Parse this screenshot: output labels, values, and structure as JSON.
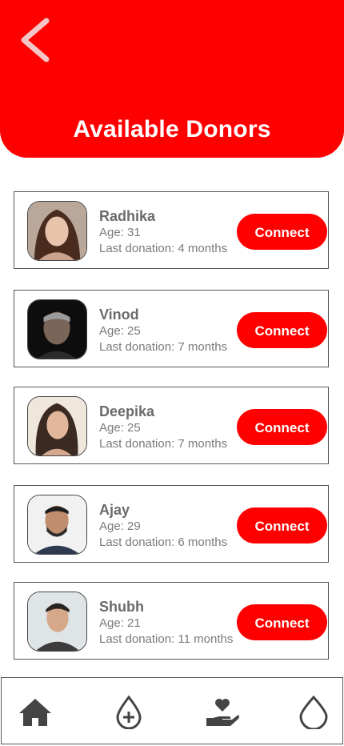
{
  "header": {
    "title": "Available Donors",
    "back_icon": "chevron-left-icon",
    "background_color": "#ff0000"
  },
  "donors": [
    {
      "name": "Radhika",
      "age": "Age: 31",
      "last_donation": "Last donation: 4 months",
      "connect_label": "Connect"
    },
    {
      "name": "Vinod",
      "age": "Age: 25",
      "last_donation": "Last donation: 7 months",
      "connect_label": "Connect"
    },
    {
      "name": "Deepika",
      "age": "Age: 25",
      "last_donation": "Last donation: 7 months",
      "connect_label": "Connect"
    },
    {
      "name": "Ajay",
      "age": "Age: 29",
      "last_donation": "Last donation: 6 months",
      "connect_label": "Connect"
    },
    {
      "name": "Shubh",
      "age": "Age: 21",
      "last_donation": "Last donation: 11 months",
      "connect_label": "Connect"
    }
  ],
  "bottom_nav": {
    "items": [
      {
        "icon": "home-icon"
      },
      {
        "icon": "blood-drop-plus-icon"
      },
      {
        "icon": "heart-hand-icon"
      },
      {
        "icon": "blood-drop-icon"
      }
    ]
  },
  "colors": {
    "accent": "#ff0000",
    "text_gray": "#6b6b6b",
    "icon_gray": "#444444"
  }
}
